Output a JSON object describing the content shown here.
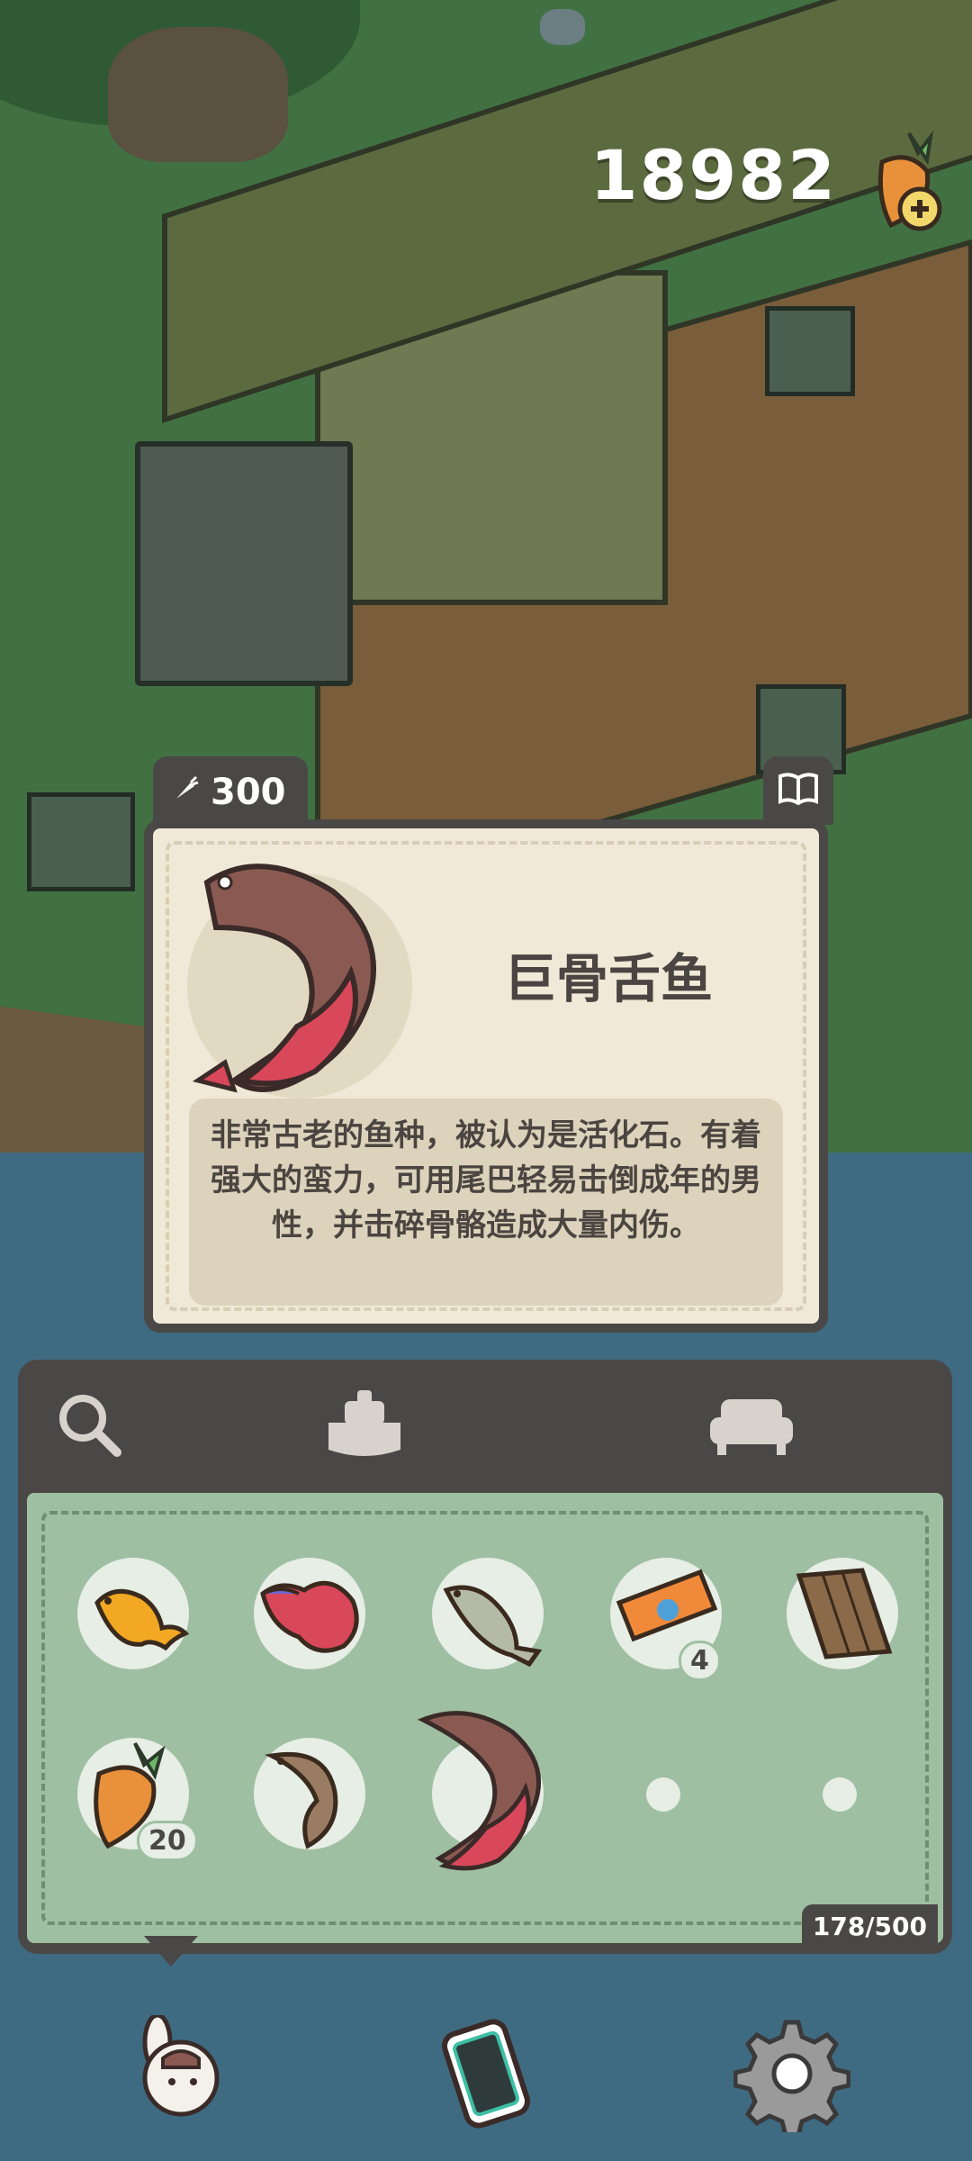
{
  "hud": {
    "currency_amount": "18982",
    "currency_icon": "carrot-plus-icon"
  },
  "fish_card": {
    "price": "300",
    "price_icon": "carrot-icon",
    "book_icon": "book-icon",
    "name": "巨骨舌鱼",
    "description": "非常古老的鱼种，被认为是活化石。有着强大的蛮力，可用尾巴轻易击倒成年的男性，并击碎骨骼造成大量内伤。"
  },
  "inventory": {
    "tabs": [
      {
        "icon": "magnifier-icon"
      },
      {
        "icon": "bait-box-icon"
      },
      {
        "icon": "sofa-icon"
      }
    ],
    "items": [
      {
        "icon": "goldfish-icon",
        "count": ""
      },
      {
        "icon": "betta-fish-icon",
        "count": ""
      },
      {
        "icon": "grey-fish-icon",
        "count": ""
      },
      {
        "icon": "ticket-icon",
        "count": "4"
      },
      {
        "icon": "wood-plank-icon",
        "count": ""
      },
      {
        "icon": "carrot-icon",
        "count": "20"
      },
      {
        "icon": "catfish-icon",
        "count": ""
      },
      {
        "icon": "arapaima-icon",
        "count": ""
      }
    ],
    "capacity": "178/500"
  },
  "bottom_nav": [
    {
      "icon": "rabbit-avatar-icon"
    },
    {
      "icon": "phone-icon"
    },
    {
      "icon": "gear-icon"
    }
  ]
}
